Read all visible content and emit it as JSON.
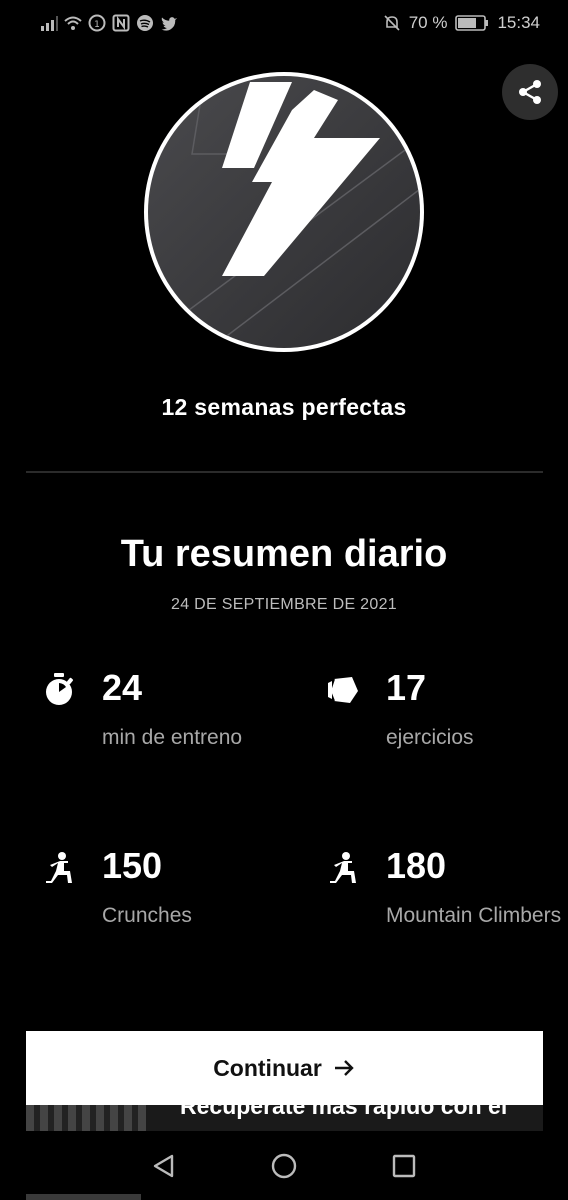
{
  "status_bar": {
    "battery_text": "70 %",
    "time": "15:34"
  },
  "achievement": {
    "subtitle": "12 semanas perfectas"
  },
  "summary": {
    "title": "Tu resumen diario",
    "date": "24 DE SEPTIEMBRE DE 2021",
    "stats": [
      {
        "icon": "stopwatch-icon",
        "value": "24",
        "label": "min de entreno"
      },
      {
        "icon": "exercises-icon",
        "value": "17",
        "label": "ejercicios"
      },
      {
        "icon": "workout-figure-icon",
        "value": "150",
        "label": "Crunches"
      },
      {
        "icon": "workout-figure-icon",
        "value": "180",
        "label": "Mountain Climbers"
      }
    ]
  },
  "cta": {
    "label": "Continuar"
  },
  "peek_card": {
    "text": "Recupérate más rápido con el"
  },
  "colors": {
    "background": "#000000",
    "text": "#ffffff",
    "muted": "#a8a8a8",
    "button_bg": "#ffffff"
  }
}
